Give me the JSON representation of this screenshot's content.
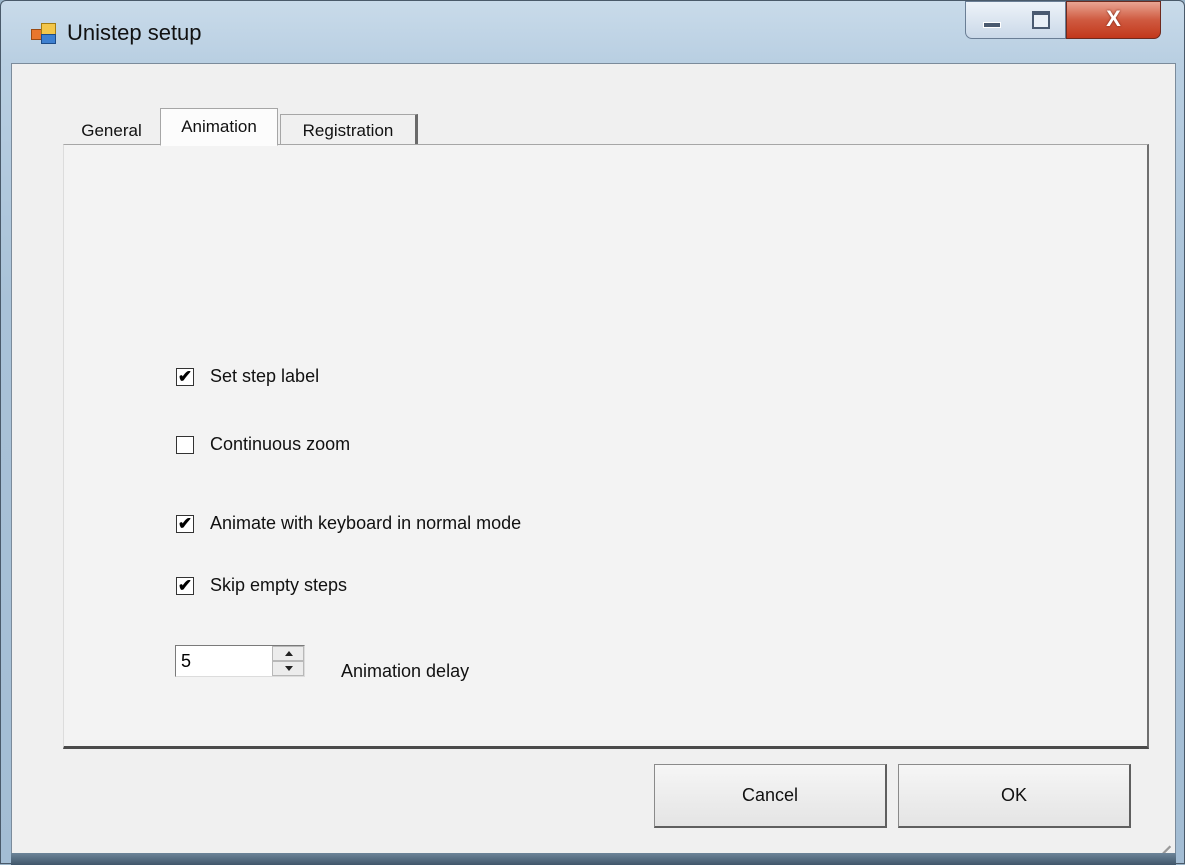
{
  "window": {
    "title": "Unistep setup",
    "icon": "unistep-app-icon",
    "controls": {
      "minimize": "minimize-icon",
      "maximize": "maximize-icon",
      "close": "X"
    }
  },
  "tabs": [
    {
      "label": "General",
      "selected": false
    },
    {
      "label": "Animation",
      "selected": true
    },
    {
      "label": "Registration",
      "selected": false
    }
  ],
  "animation": {
    "options": [
      {
        "label": "Set step label",
        "checked": true
      },
      {
        "label": "Continuous zoom",
        "checked": false
      },
      {
        "label": "Animate with keyboard in normal mode",
        "checked": true
      },
      {
        "label": "Skip empty steps",
        "checked": true
      }
    ],
    "delay": {
      "value": "5",
      "label": "Animation delay"
    }
  },
  "buttons": {
    "cancel": "Cancel",
    "ok": "OK"
  },
  "check_glyph": "✔"
}
